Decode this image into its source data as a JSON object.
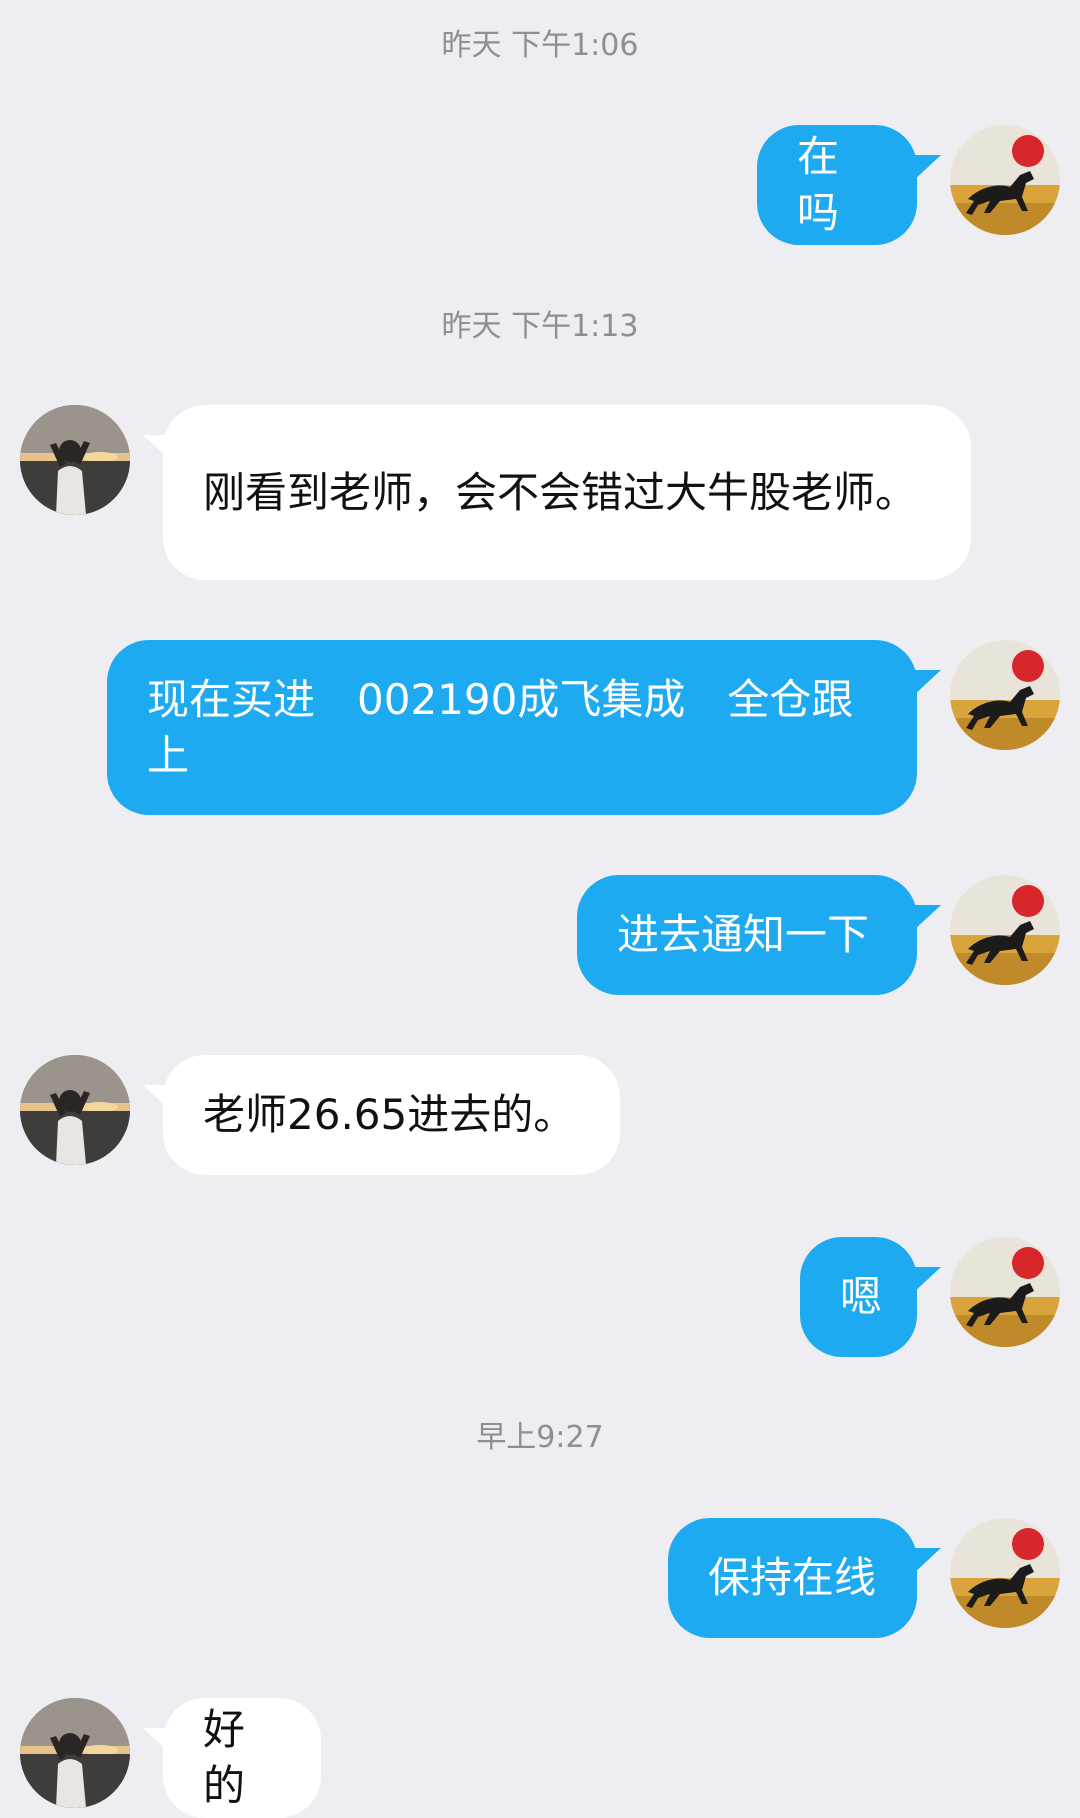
{
  "conversation": {
    "timestamps": [
      "昨天 下午1:06",
      "昨天 下午1:13",
      "早上9:27"
    ],
    "messages": [
      {
        "from": "me",
        "text": "在吗"
      },
      {
        "from": "them",
        "text": "刚看到老师，会不会错过大牛股老师。"
      },
      {
        "from": "me",
        "text": "现在买进　002190成飞集成　全仓跟上"
      },
      {
        "from": "me",
        "text": "进去通知一下"
      },
      {
        "from": "them",
        "text": "老师26.65进去的。"
      },
      {
        "from": "me",
        "text": "嗯"
      },
      {
        "from": "me",
        "text": "保持在线"
      },
      {
        "from": "them",
        "text": "好的"
      }
    ]
  },
  "avatars": {
    "me": "running-horse-sunset-avatar",
    "them": "person-at-sunset-avatar"
  },
  "colors": {
    "background": "#ededf2",
    "outgoing_bubble": "#1eaaf1",
    "incoming_bubble": "#ffffff",
    "timestamp_text": "#8e8e93"
  }
}
